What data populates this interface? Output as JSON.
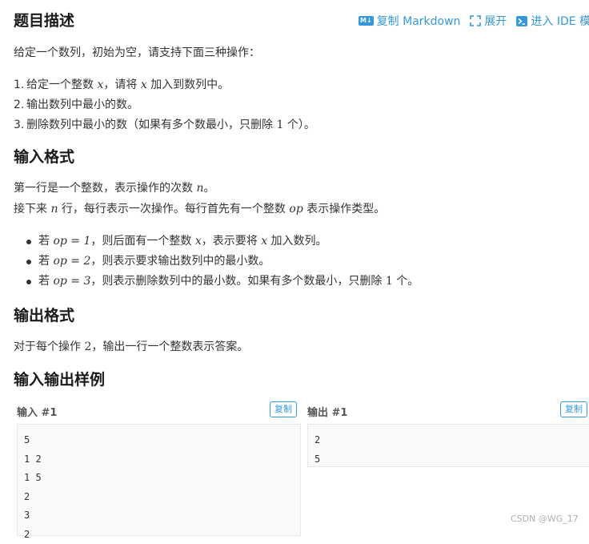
{
  "header": {
    "title": "题目描述",
    "toolbar": {
      "copy_markdown": "复制 Markdown",
      "expand": "展开",
      "enter_ide": "进入 IDE 模式",
      "md_badge": "M↓"
    }
  },
  "description": {
    "intro": "给定一个数列，初始为空，请支持下面三种操作：",
    "ops": [
      {
        "num": "1.",
        "a": "给定一个整数 ",
        "v1": "x",
        "b": "，请将 ",
        "v2": "x",
        "c": " 加入到数列中。"
      },
      {
        "num": "2.",
        "text": "输出数列中最小的数。"
      },
      {
        "num": "3.",
        "a": "删除数列中最小的数（如果有多个数最小，只删除 ",
        "n": "1",
        "b": " 个）。"
      }
    ]
  },
  "input_format": {
    "title": "输入格式",
    "line1_a": "第一行是一个整数，表示操作的次数 ",
    "line1_v": "n",
    "line1_b": "。",
    "line2_a": "接下来 ",
    "line2_v": "n",
    "line2_b": " 行，每行表示一次操作。每行首先有一个整数 ",
    "line2_v2": "op",
    "line2_c": " 表示操作类型。",
    "bullets": [
      {
        "pre": "若 ",
        "op": "op = 1",
        "a": "，则后面有一个整数 ",
        "v1": "x",
        "b": "，表示要将 ",
        "v2": "x",
        "c": " 加入数列。"
      },
      {
        "pre": "若 ",
        "op": "op = 2",
        "a": "，则表示要求输出数列中的最小数。"
      },
      {
        "pre": "若 ",
        "op": "op = 3",
        "a": "，则表示删除数列中的最小数。如果有多个数最小，只删除 ",
        "n": "1",
        "b": " 个。"
      }
    ]
  },
  "output_format": {
    "title": "输出格式",
    "a": "对于每个操作 ",
    "n": "2",
    "b": "，输出一行一个整数表示答案。"
  },
  "samples": {
    "title": "输入输出样例",
    "copy_label": "复制",
    "input": {
      "label": "输入 #1",
      "lines": [
        "5",
        "1 2",
        "1 5",
        "2",
        "3",
        "2"
      ]
    },
    "output": {
      "label": "输出 #1",
      "lines": [
        "2",
        "5"
      ]
    }
  },
  "watermark": "CSDN @WG_17",
  "colors": {
    "accent": "#3498db",
    "text": "#333333",
    "code_bg": "#fafafa"
  }
}
